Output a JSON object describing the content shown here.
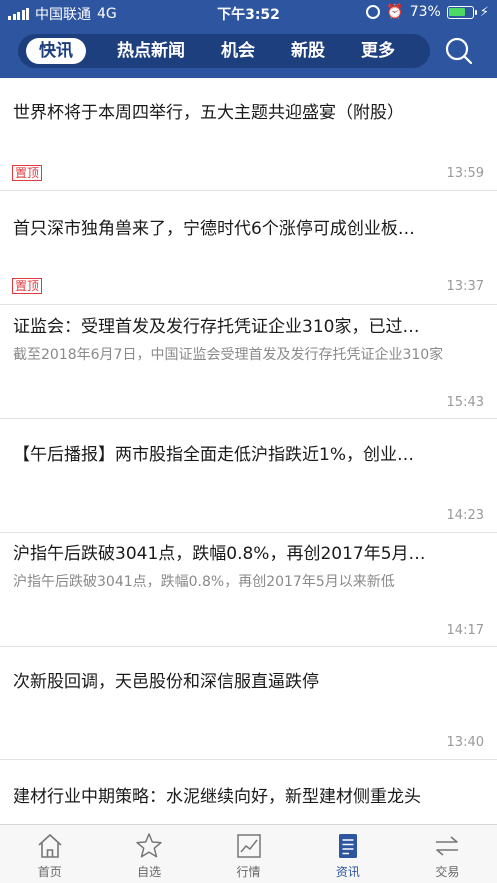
{
  "status": {
    "carrier": "中国联通",
    "network": "4G",
    "time": "下午3:52",
    "battery": "73%",
    "battery_level": 0.73
  },
  "nav": {
    "tabs": [
      {
        "label": "快讯",
        "active": true
      },
      {
        "label": "热点新闻"
      },
      {
        "label": "机会"
      },
      {
        "label": "新股"
      },
      {
        "label": "更多"
      }
    ],
    "search_icon": "search-icon"
  },
  "feed": [
    {
      "title": "世界杯将于本周四举行，五大主题共迎盛宴（附股）",
      "tag": "置顶",
      "time": "13:59"
    },
    {
      "title": "首只深市独角兽来了，宁德时代6个涨停可成创业板…",
      "tag": "置顶",
      "time": "13:37"
    },
    {
      "title": "证监会：受理首发及发行存托凭证企业310家，已过…",
      "summary": "截至2018年6月7日，中国证监会受理首发及发行存托凭证企业310家",
      "time": "15:43"
    },
    {
      "title": "【午后播报】两市股指全面走低沪指跌近1%，创业…",
      "time": "14:23"
    },
    {
      "title": "沪指午后跌破3041点，跌幅0.8%，再创2017年5月…",
      "summary": "沪指午后跌破3041点，跌幅0.8%，再创2017年5月以来新低",
      "time": "14:17"
    },
    {
      "title": "次新股回调，天邑股份和深信服直逼跌停",
      "time": "13:40"
    },
    {
      "title": "建材行业中期策略：水泥继续向好，新型建材侧重龙头"
    }
  ],
  "tabbar": [
    {
      "label": "首页",
      "icon": "home-icon"
    },
    {
      "label": "自选",
      "icon": "star-icon"
    },
    {
      "label": "行情",
      "icon": "chart-icon"
    },
    {
      "label": "资讯",
      "icon": "news-icon",
      "active": true
    },
    {
      "label": "交易",
      "icon": "exchange-icon"
    }
  ],
  "colors": {
    "header": "#2d55a0",
    "nav_pill": "#1d3f7e",
    "tag_red": "#e4393c",
    "active_tab": "#2d55a0"
  }
}
